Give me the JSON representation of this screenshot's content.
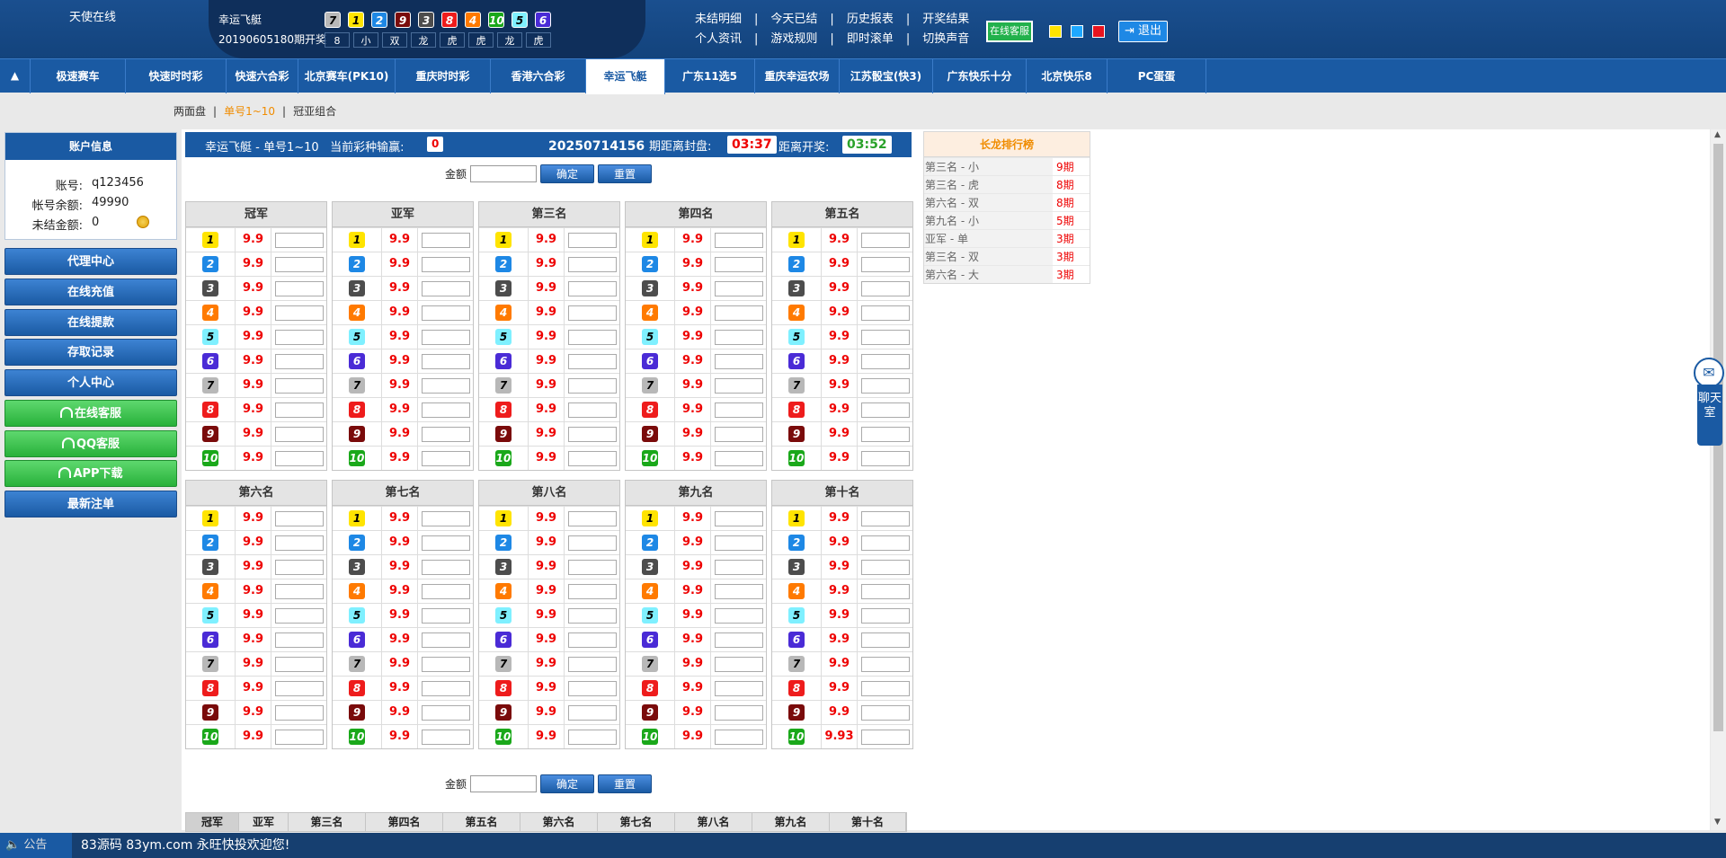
{
  "header": {
    "site_name": "天使在线",
    "game_name": "幸运飞艇",
    "draw_info": "20190605180期开奖",
    "result_balls": [
      "7",
      "1",
      "2",
      "9",
      "3",
      "8",
      "4",
      "10",
      "5",
      "6"
    ],
    "result_attrs": [
      "8",
      "小",
      "双",
      "龙",
      "虎",
      "虎",
      "龙",
      "虎"
    ],
    "links_row1": [
      "未结明细",
      "今天已结",
      "历史报表",
      "开奖结果"
    ],
    "links_row2": [
      "个人资讯",
      "游戏规则",
      "即时滚单",
      "切换声音"
    ],
    "service_label": "在线客服",
    "logout_label": "退出",
    "square_colors": [
      "#ffe300",
      "#1ea8ff",
      "#e8141e"
    ]
  },
  "nav": {
    "toggle_icon": "▲",
    "tabs": [
      "极速赛车",
      "快速时时彩",
      "快速六合彩",
      "北京赛车(PK10)",
      "重庆时时彩",
      "香港六合彩",
      "幸运飞艇",
      "广东11选5",
      "重庆幸运农场",
      "江苏骰宝(快3)",
      "广东快乐十分",
      "北京快乐8",
      "PC蛋蛋"
    ]
  },
  "subnav": {
    "items": [
      "两面盘",
      "单号1~10",
      "冠亚组合"
    ]
  },
  "account": {
    "title": "账户信息",
    "labels": [
      "账号:",
      "帐号余额:",
      "未结金额:"
    ],
    "values": [
      "q123456",
      "49990",
      "0"
    ]
  },
  "sidebar": {
    "buttons": [
      "代理中心",
      "在线充值",
      "在线提款",
      "存取记录",
      "个人中心",
      "在线客服",
      "QQ客服",
      "APP下载",
      "最新注单"
    ]
  },
  "topbar": {
    "title": "幸运飞艇 - 单号1~10",
    "loss_label": "当前彩种输赢:",
    "loss_value": "0",
    "issue": "20250714156",
    "close_label": "期距离封盘:",
    "close_time": "03:37",
    "open_label": "距离开奖:",
    "open_time": "03:52"
  },
  "amount": {
    "label": "金额",
    "confirm": "确定",
    "reset": "重置"
  },
  "positions": [
    {
      "title": "冠军",
      "odds": [
        "9.9",
        "9.9",
        "9.9",
        "9.9",
        "9.9",
        "9.9",
        "9.9",
        "9.9",
        "9.9",
        "9.9"
      ]
    },
    {
      "title": "亚军",
      "odds": [
        "9.9",
        "9.9",
        "9.9",
        "9.9",
        "9.9",
        "9.9",
        "9.9",
        "9.9",
        "9.9",
        "9.9"
      ]
    },
    {
      "title": "第三名",
      "odds": [
        "9.9",
        "9.9",
        "9.9",
        "9.9",
        "9.9",
        "9.9",
        "9.9",
        "9.9",
        "9.9",
        "9.9"
      ]
    },
    {
      "title": "第四名",
      "odds": [
        "9.9",
        "9.9",
        "9.9",
        "9.9",
        "9.9",
        "9.9",
        "9.9",
        "9.9",
        "9.9",
        "9.9"
      ]
    },
    {
      "title": "第五名",
      "odds": [
        "9.9",
        "9.9",
        "9.9",
        "9.9",
        "9.9",
        "9.9",
        "9.9",
        "9.9",
        "9.9",
        "9.9"
      ]
    },
    {
      "title": "第六名",
      "odds": [
        "9.9",
        "9.9",
        "9.9",
        "9.9",
        "9.9",
        "9.9",
        "9.9",
        "9.9",
        "9.9",
        "9.9"
      ]
    },
    {
      "title": "第七名",
      "odds": [
        "9.9",
        "9.9",
        "9.9",
        "9.9",
        "9.9",
        "9.9",
        "9.9",
        "9.9",
        "9.9",
        "9.9"
      ]
    },
    {
      "title": "第八名",
      "odds": [
        "9.9",
        "9.9",
        "9.9",
        "9.9",
        "9.9",
        "9.9",
        "9.9",
        "9.9",
        "9.9",
        "9.9"
      ]
    },
    {
      "title": "第九名",
      "odds": [
        "9.9",
        "9.9",
        "9.9",
        "9.9",
        "9.9",
        "9.9",
        "9.9",
        "9.9",
        "9.9",
        "9.9"
      ]
    },
    {
      "title": "第十名",
      "odds": [
        "9.9",
        "9.9",
        "9.9",
        "9.9",
        "9.9",
        "9.9",
        "9.9",
        "9.9",
        "9.9",
        "9.93"
      ]
    }
  ],
  "ball_colors": {
    "1": {
      "bg": "#ffe400",
      "fg": "#000"
    },
    "2": {
      "bg": "#1e88e5",
      "fg": "#fff"
    },
    "3": {
      "bg": "#4d4d4d",
      "fg": "#fff"
    },
    "4": {
      "bg": "#ff7a00",
      "fg": "#fff"
    },
    "5": {
      "bg": "#7ff0ff",
      "fg": "#000"
    },
    "6": {
      "bg": "#4a2bd6",
      "fg": "#fff"
    },
    "7": {
      "bg": "#b8b8b8",
      "fg": "#000"
    },
    "8": {
      "bg": "#ee1c1c",
      "fg": "#fff"
    },
    "9": {
      "bg": "#7a0b0b",
      "fg": "#fff"
    },
    "10": {
      "bg": "#1aa81a",
      "fg": "#fff"
    }
  },
  "bottom_tabs": [
    "冠军",
    "亚军",
    "第三名",
    "第四名",
    "第五名",
    "第六名",
    "第七名",
    "第八名",
    "第九名",
    "第十名"
  ],
  "longdragon": {
    "title": "长龙排行榜",
    "rows": [
      {
        "name": "第三名 - 小",
        "count": "9期"
      },
      {
        "name": "第三名 - 虎",
        "count": "8期"
      },
      {
        "name": "第六名 - 双",
        "count": "8期"
      },
      {
        "name": "第九名 - 小",
        "count": "5期"
      },
      {
        "name": "亚军 - 单",
        "count": "3期"
      },
      {
        "name": "第三名 - 双",
        "count": "3期"
      },
      {
        "name": "第六名 - 大",
        "count": "3期"
      }
    ]
  },
  "chat": {
    "label": "聊天室"
  },
  "footer": {
    "ann_label": "公告",
    "ann_text": "83源码 83ym.com 永旺快投欢迎您!"
  }
}
